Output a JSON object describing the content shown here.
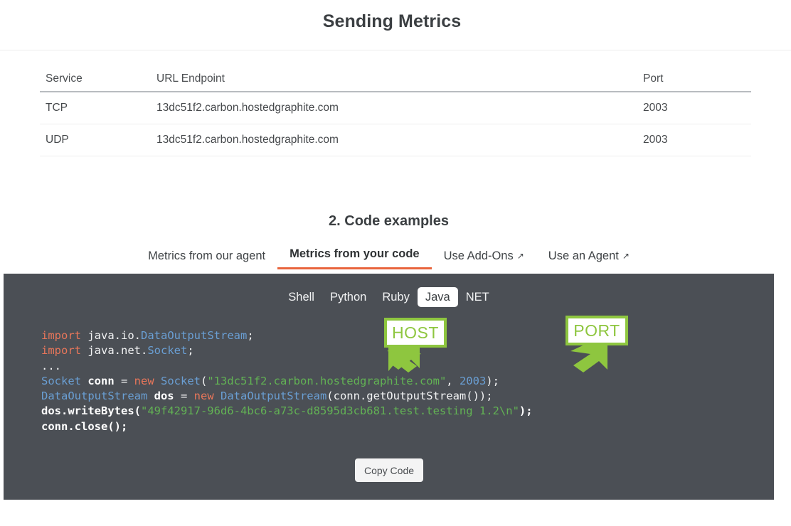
{
  "header": {
    "title": "Sending Metrics"
  },
  "endpoints_table": {
    "columns": [
      "Service",
      "URL Endpoint",
      "Port"
    ],
    "rows": [
      [
        "TCP",
        "13dc51f2.carbon.hostedgraphite.com",
        "2003"
      ],
      [
        "UDP",
        "13dc51f2.carbon.hostedgraphite.com",
        "2003"
      ]
    ]
  },
  "code_section": {
    "heading": "2. Code examples",
    "tabs": [
      {
        "label": "Metrics from our agent",
        "active": false,
        "external": false
      },
      {
        "label": "Metrics from your code",
        "active": true,
        "external": false
      },
      {
        "label": "Use Add-Ons",
        "active": false,
        "external": true
      },
      {
        "label": "Use an Agent",
        "active": false,
        "external": true
      }
    ],
    "external_icon": "↗",
    "languages": [
      {
        "label": "Shell",
        "selected": false
      },
      {
        "label": "Python",
        "selected": false
      },
      {
        "label": "Ruby",
        "selected": false
      },
      {
        "label": "Java",
        "selected": true
      },
      {
        "label": "NET",
        "selected": false
      }
    ],
    "copy_button": "Copy Code",
    "code_lines": {
      "line1_kw": "import",
      "line1_pkg": " java.io.",
      "line1_type": "DataOutputStream",
      "line1_end": ";",
      "line2_kw": "import",
      "line2_pkg": " java.net.",
      "line2_type": "Socket",
      "line2_end": ";",
      "line3_dots": "...",
      "line4_type": "Socket",
      "line4_var": " conn ",
      "line4_eq": "= ",
      "line4_new": "new",
      "line4_ctor": " Socket",
      "line4_open": "(",
      "line4_host": "\"13dc51f2.carbon.hostedgraphite.com\"",
      "line4_comma": ", ",
      "line4_port": "2003",
      "line4_close": ");",
      "line5_type": "DataOutputStream",
      "line5_var": " dos ",
      "line5_eq": "= ",
      "line5_new": "new",
      "line5_ctor": " DataOutputStream",
      "line5_args": "(conn.getOutputStream());",
      "line6_call": "dos.writeBytes(",
      "line6_str": "\"49f42917-96d6-4bc6-a73c-d8595d3cb681.test.testing 1.2\\n\"",
      "line6_end": ");",
      "line7_call": "conn.close();"
    },
    "annotations": {
      "host_label": "HOST",
      "port_label": "PORT"
    }
  },
  "colors": {
    "code_background": "#4b4f55",
    "active_tab_underline": "#e8643c",
    "annotation_green": "#8ec63f",
    "string_green": "#62b254",
    "keyword_orange": "#e8765a",
    "type_blue": "#6a9fd4"
  }
}
